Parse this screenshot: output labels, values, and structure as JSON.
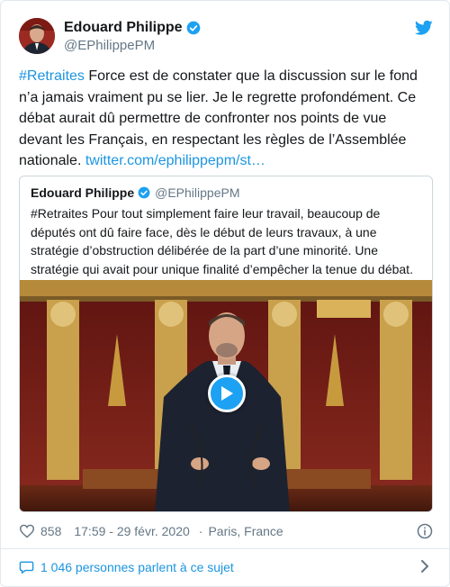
{
  "author": {
    "display_name": "Edouard Philippe",
    "handle": "@EPhilippePM"
  },
  "tweet": {
    "hashtag": "#Retraites",
    "body": " Force est de constater que la discussion sur le fond n’a jamais vraiment pu se lier. Je le regrette profondément. Ce débat aurait dû permettre de confronter nos points de vue devant les Français, en respectant les règles de l’Assemblée nationale. ",
    "link": "twitter.com/ephilippepm/st…"
  },
  "quoted": {
    "display_name": "Edouard Philippe",
    "handle": "@EPhilippePM",
    "text": "#Retraites Pour tout simplement faire leur travail, beaucoup de députés ont dû faire face, dès le début de leurs travaux, à une stratégie d’obstruction délibérée de la part d’une minorité. Une stratégie qui avait pour unique finalité d’empêcher la tenue du débat."
  },
  "footer": {
    "likes": "858",
    "timestamp": "17:59 - 29 févr. 2020",
    "separator": "·",
    "location": "Paris, France"
  },
  "conversation": {
    "label": "1 046 personnes parlent à ce sujet"
  },
  "colors": {
    "link": "#1b95e0",
    "verified": "#1da1f2",
    "muted": "#657786"
  },
  "icons": [
    "twitter-bird-icon",
    "verified-badge-icon",
    "heart-icon",
    "info-icon",
    "speech-bubble-icon",
    "chevron-right-icon",
    "play-icon"
  ]
}
